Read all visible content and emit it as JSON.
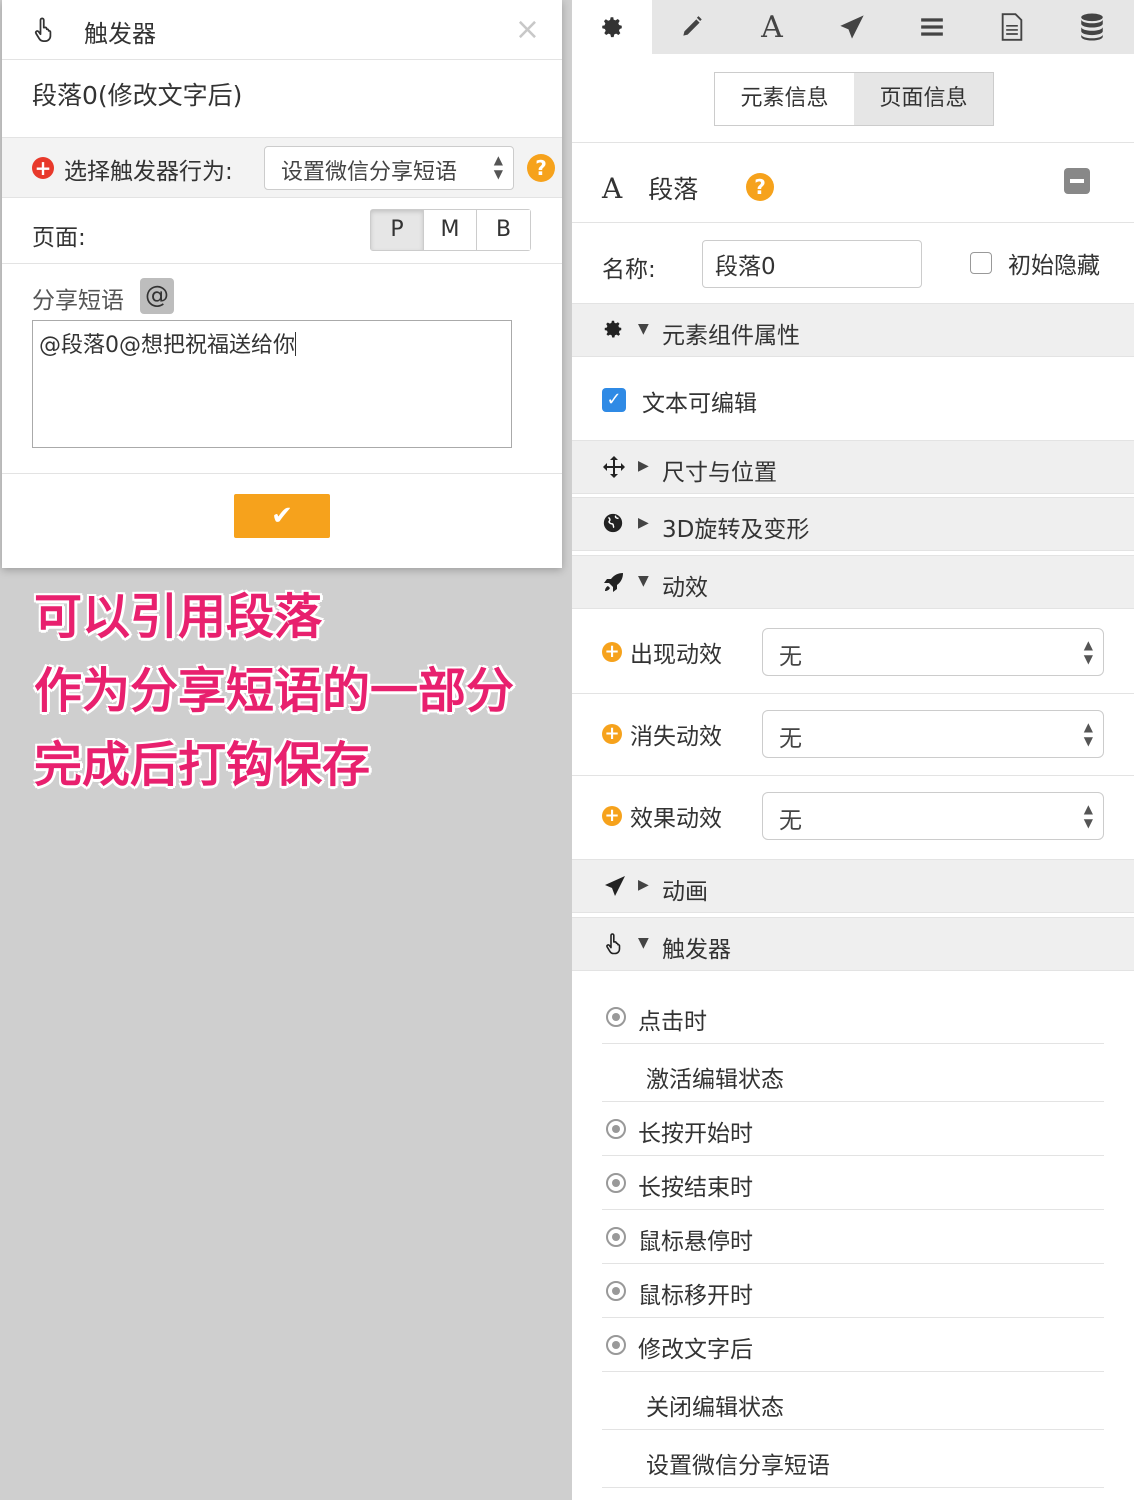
{
  "dialog": {
    "title": "触发器",
    "close": "×",
    "element_name": "段落0(修改文字后)",
    "action_label": "选择触发器行为:",
    "action_value": "设置微信分享短语",
    "help": "?",
    "page_label": "页面:",
    "page_buttons": [
      "P",
      "M",
      "B"
    ],
    "share_label": "分享短语",
    "at_label": "@",
    "share_text": "@段落0@想把祝福送给你",
    "ok": "✔"
  },
  "annotation": {
    "line1": "可以引用段落",
    "line2": "作为分享短语的一部分",
    "line3": "完成后打钩保存"
  },
  "panel": {
    "toolbar_icons": [
      "gear-icon",
      "pencil-icon",
      "font-icon",
      "send-icon",
      "list-icon",
      "document-icon",
      "database-icon"
    ],
    "tabs": [
      "元素信息",
      "页面信息"
    ],
    "element_type": "段落",
    "element_type_icon": "A",
    "help": "?",
    "name_label": "名称:",
    "name_value": "段落0",
    "hide_label": "初始隐藏",
    "sections": {
      "component": "元素组件属性",
      "size": "尺寸与位置",
      "rotate": "3D旋转及变形",
      "effects": "动效",
      "animation": "动画",
      "trigger": "触发器"
    },
    "editable_label": "文本可编辑",
    "anim_rows": [
      {
        "label": "出现动效",
        "value": "无"
      },
      {
        "label": "消失动效",
        "value": "无"
      },
      {
        "label": "效果动效",
        "value": "无"
      }
    ],
    "triggers": [
      {
        "label": "点击时"
      },
      {
        "label": "激活编辑状态"
      },
      {
        "label": "长按开始时"
      },
      {
        "label": "长按结束时"
      },
      {
        "label": "鼠标悬停时"
      },
      {
        "label": "鼠标移开时"
      },
      {
        "label": "修改文字后"
      },
      {
        "label": "关闭编辑状态"
      },
      {
        "label": "设置微信分享短语"
      }
    ]
  }
}
